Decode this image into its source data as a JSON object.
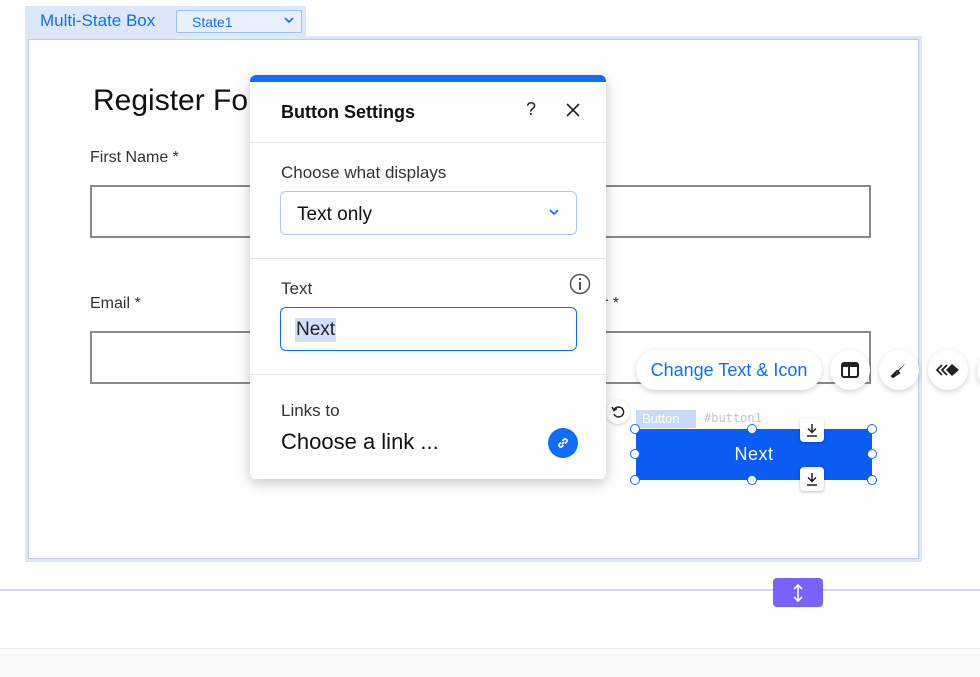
{
  "multi_state_box": {
    "label": "Multi-State Box",
    "selected_state": "State1"
  },
  "form": {
    "title": "Register Fo",
    "first_name_label": "First Name *",
    "email_label": "Email *",
    "partial_label_right": "r *"
  },
  "toolbar": {
    "change_text_label": "Change Text & Icon",
    "icons": [
      "layout-icon",
      "design-brush-icon",
      "animation-icon"
    ]
  },
  "selected_button": {
    "tag": "Button",
    "id": "#button1",
    "label": "Next",
    "fill_color": "#0b5cf5"
  },
  "panel": {
    "title": "Button Settings",
    "help_label": "?",
    "section_display_label": "Choose what displays",
    "display_value": "Text only",
    "text_label": "Text",
    "text_value": "Next",
    "links_label": "Links to",
    "link_value": "Choose a link ..."
  },
  "colors": {
    "accent": "#116dff",
    "stretch_handle": "#7b61ff"
  }
}
